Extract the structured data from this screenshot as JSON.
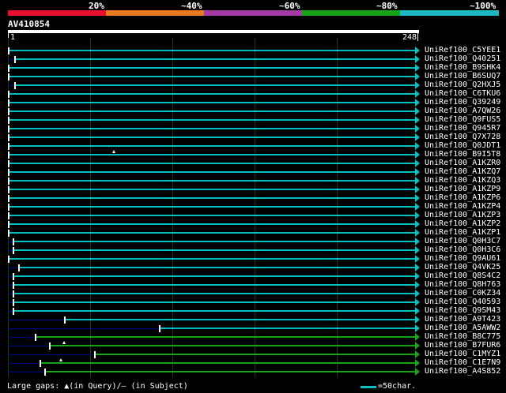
{
  "legend": {
    "labels": [
      "20%",
      "~40%",
      "~60%",
      "~80%",
      "~100%"
    ],
    "colors": [
      "#e8112d",
      "#e87b1f",
      "#a43aa5",
      "#16a316",
      "#1db8c1"
    ]
  },
  "query": {
    "id": "AV410854",
    "start": "1",
    "end": "248"
  },
  "hits": [
    {
      "label": "UniRef100_C5YEE1",
      "start": 1,
      "color": "#00c0c0"
    },
    {
      "label": "UniRef100_Q40251",
      "start": 5,
      "color": "#00c0c0"
    },
    {
      "label": "UniRef100_B9SHK4",
      "start": 1,
      "color": "#00c0c0"
    },
    {
      "label": "UniRef100_B6SUQ7",
      "start": 1,
      "color": "#00c0c0"
    },
    {
      "label": "UniRef100_Q2HXJ5",
      "start": 5,
      "color": "#00c0c0"
    },
    {
      "label": "UniRef100_C6TKU6",
      "start": 1,
      "color": "#00c0c0"
    },
    {
      "label": "UniRef100_Q39249",
      "start": 1,
      "color": "#00c0c0"
    },
    {
      "label": "UniRef100_A7QW26",
      "start": 1,
      "color": "#00c0c0"
    },
    {
      "label": "UniRef100_Q9FUS5",
      "start": 1,
      "color": "#00c0c0"
    },
    {
      "label": "UniRef100_Q945R7",
      "start": 1,
      "color": "#00c0c0"
    },
    {
      "label": "UniRef100_Q7X728",
      "start": 1,
      "color": "#00c0c0"
    },
    {
      "label": "UniRef100_Q0JDT1",
      "start": 1,
      "color": "#00c0c0"
    },
    {
      "label": "UniRef100_B9I5T8",
      "start": 1,
      "color": "#00c0c0",
      "gap": 65
    },
    {
      "label": "UniRef100_A1KZR0",
      "start": 1,
      "color": "#00c0c0"
    },
    {
      "label": "UniRef100_A1KZQ7",
      "start": 1,
      "color": "#00c0c0"
    },
    {
      "label": "UniRef100_A1KZQ3",
      "start": 1,
      "color": "#00c0c0"
    },
    {
      "label": "UniRef100_A1KZP9",
      "start": 1,
      "color": "#00c0c0"
    },
    {
      "label": "UniRef100_A1KZP6",
      "start": 1,
      "color": "#00c0c0"
    },
    {
      "label": "UniRef100_A1KZP4",
      "start": 1,
      "color": "#00c0c0"
    },
    {
      "label": "UniRef100_A1KZP3",
      "start": 1,
      "color": "#00c0c0"
    },
    {
      "label": "UniRef100_A1KZP2",
      "start": 1,
      "color": "#00c0c0"
    },
    {
      "label": "UniRef100_A1KZP1",
      "start": 1,
      "color": "#00c0c0"
    },
    {
      "label": "UniRef100_Q0H3C7",
      "start": 4,
      "color": "#00c0c0"
    },
    {
      "label": "UniRef100_Q0H3C6",
      "start": 4,
      "color": "#00c0c0"
    },
    {
      "label": "UniRef100_Q9AU61",
      "start": 1,
      "color": "#00c0c0"
    },
    {
      "label": "UniRef100_Q4VK25",
      "start": 7,
      "color": "#00c0c0"
    },
    {
      "label": "UniRef100_Q8S4C2",
      "start": 4,
      "color": "#00c0c0"
    },
    {
      "label": "UniRef100_Q8H763",
      "start": 4,
      "color": "#00c0c0"
    },
    {
      "label": "UniRef100_C0KZ34",
      "start": 4,
      "color": "#00c0c0"
    },
    {
      "label": "UniRef100_Q40593",
      "start": 4,
      "color": "#00c0c0"
    },
    {
      "label": "UniRef100_Q9SM43",
      "start": 4,
      "color": "#00c0c0"
    },
    {
      "label": "UniRef100_A9T423",
      "start": 35,
      "color": "#00c0c0"
    },
    {
      "label": "UniRef100_A5AWW2",
      "start": 92,
      "color": "#00c0c0"
    },
    {
      "label": "UniRef100_B8C775",
      "start": 17,
      "color": "#16a316"
    },
    {
      "label": "UniRef100_B7FUR6",
      "start": 26,
      "color": "#16a316",
      "gap": 35
    },
    {
      "label": "UniRef100_C1MYZ1",
      "start": 53,
      "color": "#16a316"
    },
    {
      "label": "UniRef100_C1E7N9",
      "start": 20,
      "color": "#16a316",
      "gap": 33
    },
    {
      "label": "UniRef100_A4S852",
      "start": 23,
      "color": "#16a316"
    }
  ],
  "footer": {
    "gaps_text": "Large gaps: ▲(in Query)/– (in Subject)",
    "scale_text": "=50char."
  }
}
